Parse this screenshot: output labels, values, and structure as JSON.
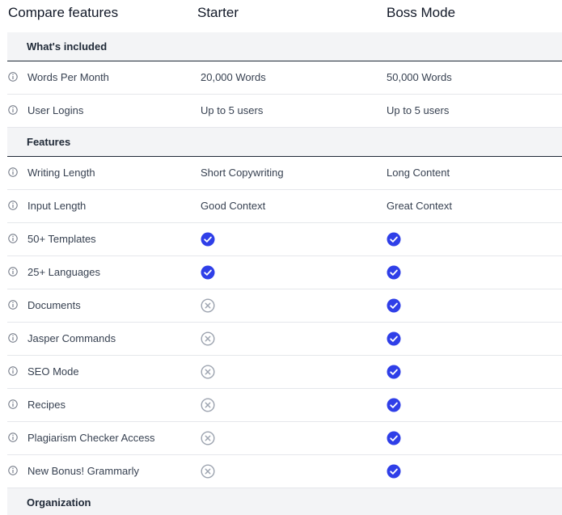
{
  "header": {
    "title": "Compare features",
    "plan_1": "Starter",
    "plan_2": "Boss Mode"
  },
  "sections": [
    {
      "name": "What's included",
      "rows": [
        {
          "label": "Words Per Month",
          "starter": "20,000 Words",
          "boss": "50,000 Words"
        },
        {
          "label": "User Logins",
          "starter": "Up to 5 users",
          "boss": "Up to 5 users"
        }
      ]
    },
    {
      "name": "Features",
      "rows": [
        {
          "label": "Writing Length",
          "starter": "Short Copywriting",
          "boss": "Long Content"
        },
        {
          "label": "Input Length",
          "starter": "Good Context",
          "boss": "Great Context"
        },
        {
          "label": "50+ Templates",
          "starter_icon": "check-icon",
          "boss_icon": "check-icon"
        },
        {
          "label": "25+ Languages",
          "starter_icon": "check-icon",
          "boss_icon": "check-icon"
        },
        {
          "label": "Documents",
          "starter_icon": "x-icon",
          "boss_icon": "check-icon"
        },
        {
          "label": "Jasper Commands",
          "starter_icon": "x-icon",
          "boss_icon": "check-icon"
        },
        {
          "label": "SEO Mode",
          "starter_icon": "x-icon",
          "boss_icon": "check-icon"
        },
        {
          "label": "Recipes",
          "starter_icon": "x-icon",
          "boss_icon": "check-icon"
        },
        {
          "label": "Plagiarism Checker Access",
          "starter_icon": "x-icon",
          "boss_icon": "check-icon"
        },
        {
          "label": "New Bonus! Grammarly",
          "starter_icon": "x-icon",
          "boss_icon": "check-icon"
        }
      ]
    },
    {
      "name": "Organization",
      "rows": []
    }
  ],
  "colors": {
    "check": "#2f3fe8",
    "x_icon": "#9ca3af",
    "info_icon": "#6b7280",
    "section_bg": "#f3f4f6"
  }
}
